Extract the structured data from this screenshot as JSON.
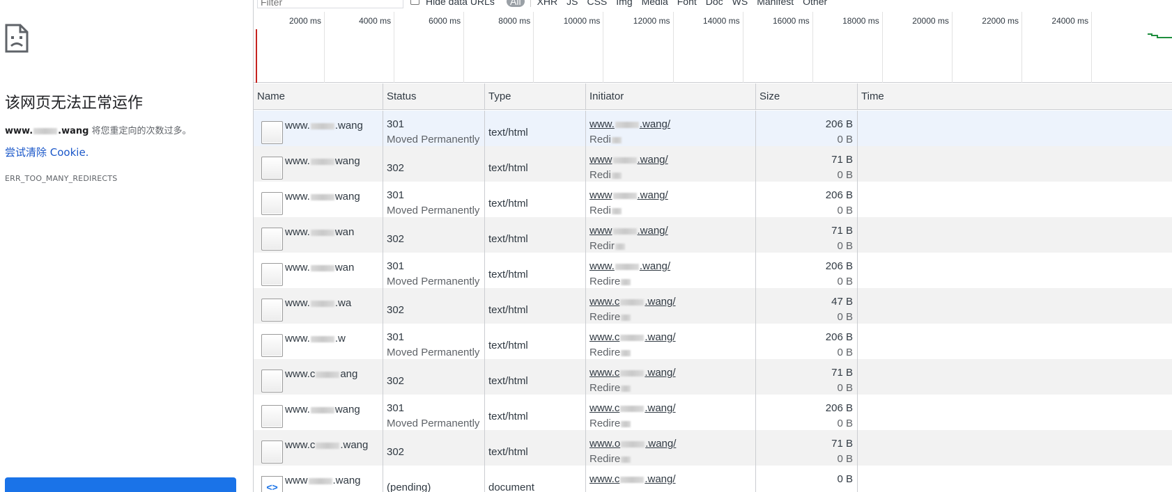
{
  "error_page": {
    "title": "该网页无法正常运作",
    "host_prefix": "www.",
    "host_suffix": ".wang",
    "desc_suffix": " 将您重定向的次数过多。",
    "link": "尝试清除 Cookie.",
    "code": "ERR_TOO_MANY_REDIRECTS",
    "icon": "sad-page-icon"
  },
  "toolbar": {
    "filter_placeholder": "Filter",
    "hide_data_urls": "Hide data URLs",
    "types": [
      "All",
      "XHR",
      "JS",
      "CSS",
      "Img",
      "Media",
      "Font",
      "Doc",
      "WS",
      "Manifest",
      "Other"
    ]
  },
  "overview": {
    "ticks": [
      "2000 ms",
      "4000 ms",
      "6000 ms",
      "8000 ms",
      "10000 ms",
      "12000 ms",
      "14000 ms",
      "16000 ms",
      "18000 ms",
      "20000 ms",
      "22000 ms",
      "24000 ms"
    ],
    "accent_red": "#c5221f",
    "accent_green": "#1e8e3e"
  },
  "columns": [
    "Name",
    "Status",
    "Type",
    "Initiator",
    "Size",
    "Time"
  ],
  "requests": [
    {
      "name": "www.",
      "name_tail": ".wang",
      "status": "301",
      "status_text": "Moved Permanently",
      "type": "text/html",
      "initiator": "www.",
      "initiator_tail": ".wang/",
      "initiator_sub": "Redi",
      "size": "206 B",
      "size_sub": "0 B"
    },
    {
      "name": "www.",
      "name_tail": "wang",
      "status": "302",
      "status_text": "",
      "type": "text/html",
      "initiator": "www",
      "initiator_tail": ".wang/",
      "initiator_sub": "Redi",
      "size": "71 B",
      "size_sub": "0 B"
    },
    {
      "name": "www.",
      "name_tail": "wang",
      "status": "301",
      "status_text": "Moved Permanently",
      "type": "text/html",
      "initiator": "www",
      "initiator_tail": ".wang/",
      "initiator_sub": "Redi",
      "size": "206 B",
      "size_sub": "0 B"
    },
    {
      "name": "www.",
      "name_tail": "wan",
      "status": "302",
      "status_text": "",
      "type": "text/html",
      "initiator": "www",
      "initiator_tail": ".wang/",
      "initiator_sub": "Redir",
      "size": "71 B",
      "size_sub": "0 B"
    },
    {
      "name": "www.",
      "name_tail": "wan",
      "status": "301",
      "status_text": "Moved Permanently",
      "type": "text/html",
      "initiator": "www.",
      "initiator_tail": ".wang/",
      "initiator_sub": "Redire",
      "size": "206 B",
      "size_sub": "0 B"
    },
    {
      "name": "www.",
      "name_tail": ".wa",
      "status": "302",
      "status_text": "",
      "type": "text/html",
      "initiator": "www.c",
      "initiator_tail": ".wang/",
      "initiator_sub": "Redire",
      "size": "47 B",
      "size_sub": "0 B"
    },
    {
      "name": "www.",
      "name_tail": ".w",
      "status": "301",
      "status_text": "Moved Permanently",
      "type": "text/html",
      "initiator": "www.c",
      "initiator_tail": ".wang/",
      "initiator_sub": "Redire",
      "size": "206 B",
      "size_sub": "0 B"
    },
    {
      "name": "www.c",
      "name_tail": "ang",
      "status": "302",
      "status_text": "",
      "type": "text/html",
      "initiator": "www.c",
      "initiator_tail": ".wang/",
      "initiator_sub": "Redire",
      "size": "71 B",
      "size_sub": "0 B"
    },
    {
      "name": "www.",
      "name_tail": "wang",
      "status": "301",
      "status_text": "Moved Permanently",
      "type": "text/html",
      "initiator": "www.c",
      "initiator_tail": ".wang/",
      "initiator_sub": "Redire",
      "size": "206 B",
      "size_sub": "0 B"
    },
    {
      "name": "www.c",
      "name_tail": ".wang",
      "status": "302",
      "status_text": "",
      "type": "text/html",
      "initiator": "www.o",
      "initiator_tail": ".wang/",
      "initiator_sub": "Redire",
      "size": "71 B",
      "size_sub": "0 B"
    },
    {
      "name": "www",
      "name_tail": ".wang",
      "status": "(pending)",
      "status_text": "",
      "type": "document",
      "initiator": "www.c",
      "initiator_tail": ".wang/",
      "initiator_sub": "",
      "size": "0 B",
      "size_sub": ""
    }
  ]
}
